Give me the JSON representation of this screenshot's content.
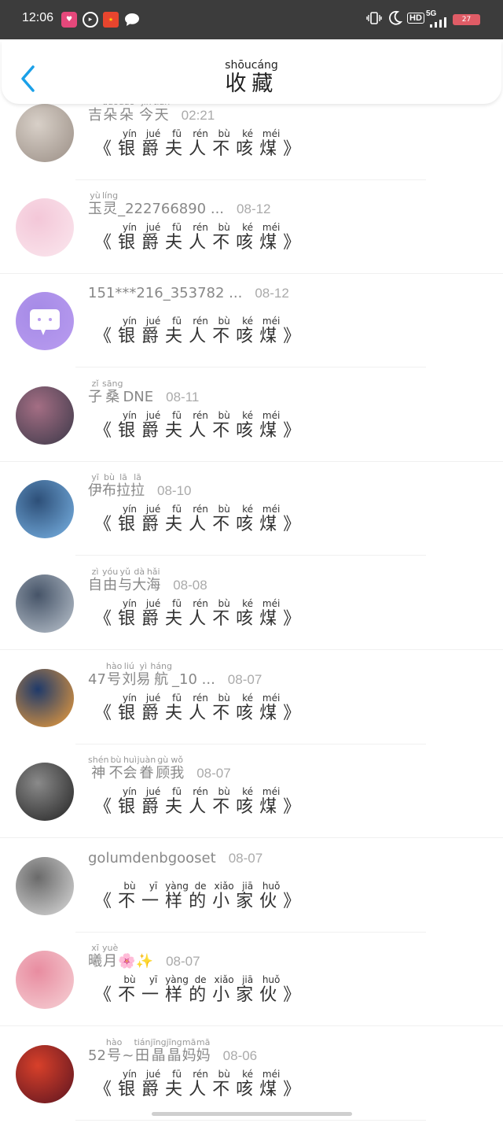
{
  "status_bar": {
    "time": "12:06",
    "right_icons": [
      "vibrate-icon",
      "moon-icon",
      "hd-icon",
      "5g-signal-icon"
    ],
    "hd": "HD",
    "network": "5G",
    "battery": "27"
  },
  "header": {
    "title_chars": [
      {
        "c": "收",
        "p": "shōu"
      },
      {
        "c": "藏",
        "p": "cáng"
      }
    ]
  },
  "colors": {
    "accent": "#1aa0e8",
    "status_bar": "#3c3c3c"
  },
  "items": [
    {
      "user": [
        {
          "c": "吉",
          "p": ""
        },
        {
          "c": "朵",
          "p": "duǒ"
        },
        {
          "c": "朵",
          "p": "duǒ"
        },
        {
          "c": " ",
          "p": ""
        },
        {
          "c": "今",
          "p": "jīn"
        },
        {
          "c": "天",
          "p": "tiān"
        }
      ],
      "time": "02:21",
      "content": [
        {
          "c": "《",
          "p": ""
        },
        {
          "c": "银",
          "p": "yín"
        },
        {
          "c": "爵",
          "p": "jué"
        },
        {
          "c": "夫",
          "p": "fū"
        },
        {
          "c": "人",
          "p": "rén"
        },
        {
          "c": "不",
          "p": "bù"
        },
        {
          "c": "咳",
          "p": "ké"
        },
        {
          "c": "煤",
          "p": "méi"
        },
        {
          "c": "》",
          "p": ""
        }
      ]
    },
    {
      "user": [
        {
          "c": "玉",
          "p": "yù"
        },
        {
          "c": "灵",
          "p": "líng"
        },
        {
          "c": "_222766890 ...",
          "p": ""
        }
      ],
      "time": "08-12",
      "content": [
        {
          "c": "《",
          "p": ""
        },
        {
          "c": "银",
          "p": "yín"
        },
        {
          "c": "爵",
          "p": "jué"
        },
        {
          "c": "夫",
          "p": "fū"
        },
        {
          "c": "人",
          "p": "rén"
        },
        {
          "c": "不",
          "p": "bù"
        },
        {
          "c": "咳",
          "p": "ké"
        },
        {
          "c": "煤",
          "p": "méi"
        },
        {
          "c": "》",
          "p": ""
        }
      ]
    },
    {
      "user": [
        {
          "c": "151***216_353782 ...",
          "p": ""
        }
      ],
      "time": "08-12",
      "content": [
        {
          "c": "《",
          "p": ""
        },
        {
          "c": "银",
          "p": "yín"
        },
        {
          "c": "爵",
          "p": "jué"
        },
        {
          "c": "夫",
          "p": "fū"
        },
        {
          "c": "人",
          "p": "rén"
        },
        {
          "c": "不",
          "p": "bù"
        },
        {
          "c": "咳",
          "p": "ké"
        },
        {
          "c": "煤",
          "p": "méi"
        },
        {
          "c": "》",
          "p": ""
        }
      ]
    },
    {
      "user": [
        {
          "c": "子",
          "p": "zǐ"
        },
        {
          "c": "桑",
          "p": "sāng"
        },
        {
          "c": "DNE",
          "p": ""
        }
      ],
      "time": "08-11",
      "content": [
        {
          "c": "《",
          "p": ""
        },
        {
          "c": "银",
          "p": "yín"
        },
        {
          "c": "爵",
          "p": "jué"
        },
        {
          "c": "夫",
          "p": "fū"
        },
        {
          "c": "人",
          "p": "rén"
        },
        {
          "c": "不",
          "p": "bù"
        },
        {
          "c": "咳",
          "p": "ké"
        },
        {
          "c": "煤",
          "p": "méi"
        },
        {
          "c": "》",
          "p": ""
        }
      ]
    },
    {
      "user": [
        {
          "c": "伊",
          "p": "yī"
        },
        {
          "c": "布",
          "p": "bù"
        },
        {
          "c": "拉",
          "p": "lā"
        },
        {
          "c": "拉",
          "p": "lā"
        }
      ],
      "time": "08-10",
      "content": [
        {
          "c": "《",
          "p": ""
        },
        {
          "c": "银",
          "p": "yín"
        },
        {
          "c": "爵",
          "p": "jué"
        },
        {
          "c": "夫",
          "p": "fū"
        },
        {
          "c": "人",
          "p": "rén"
        },
        {
          "c": "不",
          "p": "bù"
        },
        {
          "c": "咳",
          "p": "ké"
        },
        {
          "c": "煤",
          "p": "méi"
        },
        {
          "c": "》",
          "p": ""
        }
      ]
    },
    {
      "user": [
        {
          "c": "自",
          "p": "zì"
        },
        {
          "c": "由",
          "p": "yóu"
        },
        {
          "c": "与",
          "p": "yǔ"
        },
        {
          "c": "大",
          "p": "dà"
        },
        {
          "c": "海",
          "p": "hǎi"
        }
      ],
      "time": "08-08",
      "content": [
        {
          "c": "《",
          "p": ""
        },
        {
          "c": "银",
          "p": "yín"
        },
        {
          "c": "爵",
          "p": "jué"
        },
        {
          "c": "夫",
          "p": "fū"
        },
        {
          "c": "人",
          "p": "rén"
        },
        {
          "c": "不",
          "p": "bù"
        },
        {
          "c": "咳",
          "p": "ké"
        },
        {
          "c": "煤",
          "p": "méi"
        },
        {
          "c": "》",
          "p": ""
        }
      ]
    },
    {
      "user": [
        {
          "c": "47",
          "p": ""
        },
        {
          "c": "号",
          "p": "hào"
        },
        {
          "c": "刘",
          "p": "liú"
        },
        {
          "c": "易",
          "p": "yì"
        },
        {
          "c": "航",
          "p": "háng"
        },
        {
          "c": "_10 ...",
          "p": ""
        }
      ],
      "time": "08-07",
      "content": [
        {
          "c": "《",
          "p": ""
        },
        {
          "c": "银",
          "p": "yín"
        },
        {
          "c": "爵",
          "p": "jué"
        },
        {
          "c": "夫",
          "p": "fū"
        },
        {
          "c": "人",
          "p": "rén"
        },
        {
          "c": "不",
          "p": "bù"
        },
        {
          "c": "咳",
          "p": "ké"
        },
        {
          "c": "煤",
          "p": "méi"
        },
        {
          "c": "》",
          "p": ""
        }
      ]
    },
    {
      "user": [
        {
          "c": "神",
          "p": "shén"
        },
        {
          "c": "不",
          "p": "bù"
        },
        {
          "c": "会",
          "p": "huì"
        },
        {
          "c": "眷",
          "p": "juàn"
        },
        {
          "c": "顾",
          "p": "gù"
        },
        {
          "c": "我",
          "p": "wǒ"
        }
      ],
      "time": "08-07",
      "content": [
        {
          "c": "《",
          "p": ""
        },
        {
          "c": "银",
          "p": "yín"
        },
        {
          "c": "爵",
          "p": "jué"
        },
        {
          "c": "夫",
          "p": "fū"
        },
        {
          "c": "人",
          "p": "rén"
        },
        {
          "c": "不",
          "p": "bù"
        },
        {
          "c": "咳",
          "p": "ké"
        },
        {
          "c": "煤",
          "p": "méi"
        },
        {
          "c": "》",
          "p": ""
        }
      ]
    },
    {
      "user": [
        {
          "c": "golumdenbgooset",
          "p": ""
        }
      ],
      "time": "08-07",
      "content": [
        {
          "c": "《",
          "p": ""
        },
        {
          "c": "不",
          "p": "bù"
        },
        {
          "c": "一",
          "p": "yī"
        },
        {
          "c": "样",
          "p": "yàng"
        },
        {
          "c": "的",
          "p": "de"
        },
        {
          "c": "小",
          "p": "xiǎo"
        },
        {
          "c": "家",
          "p": "jiā"
        },
        {
          "c": "伙",
          "p": "huǒ"
        },
        {
          "c": "》",
          "p": ""
        }
      ]
    },
    {
      "user": [
        {
          "c": "曦",
          "p": "xī"
        },
        {
          "c": "月",
          "p": "yuè"
        },
        {
          "c": "🌸✨",
          "p": ""
        }
      ],
      "time": "08-07",
      "content": [
        {
          "c": "《",
          "p": ""
        },
        {
          "c": "不",
          "p": "bù"
        },
        {
          "c": "一",
          "p": "yī"
        },
        {
          "c": "样",
          "p": "yàng"
        },
        {
          "c": "的",
          "p": "de"
        },
        {
          "c": "小",
          "p": "xiǎo"
        },
        {
          "c": "家",
          "p": "jiā"
        },
        {
          "c": "伙",
          "p": "huǒ"
        },
        {
          "c": "》",
          "p": ""
        }
      ]
    },
    {
      "user": [
        {
          "c": "52",
          "p": ""
        },
        {
          "c": "号",
          "p": "hào"
        },
        {
          "c": "~",
          "p": ""
        },
        {
          "c": "田",
          "p": "tián"
        },
        {
          "c": "晶",
          "p": "jīng"
        },
        {
          "c": "晶",
          "p": "jīng"
        },
        {
          "c": "妈",
          "p": "mā"
        },
        {
          "c": "妈",
          "p": "mā"
        }
      ],
      "time": "08-06",
      "content": [
        {
          "c": "《",
          "p": ""
        },
        {
          "c": "银",
          "p": "yín"
        },
        {
          "c": "爵",
          "p": "jué"
        },
        {
          "c": "夫",
          "p": "fū"
        },
        {
          "c": "人",
          "p": "rén"
        },
        {
          "c": "不",
          "p": "bù"
        },
        {
          "c": "咳",
          "p": "ké"
        },
        {
          "c": "煤",
          "p": "méi"
        },
        {
          "c": "》",
          "p": ""
        }
      ]
    }
  ]
}
